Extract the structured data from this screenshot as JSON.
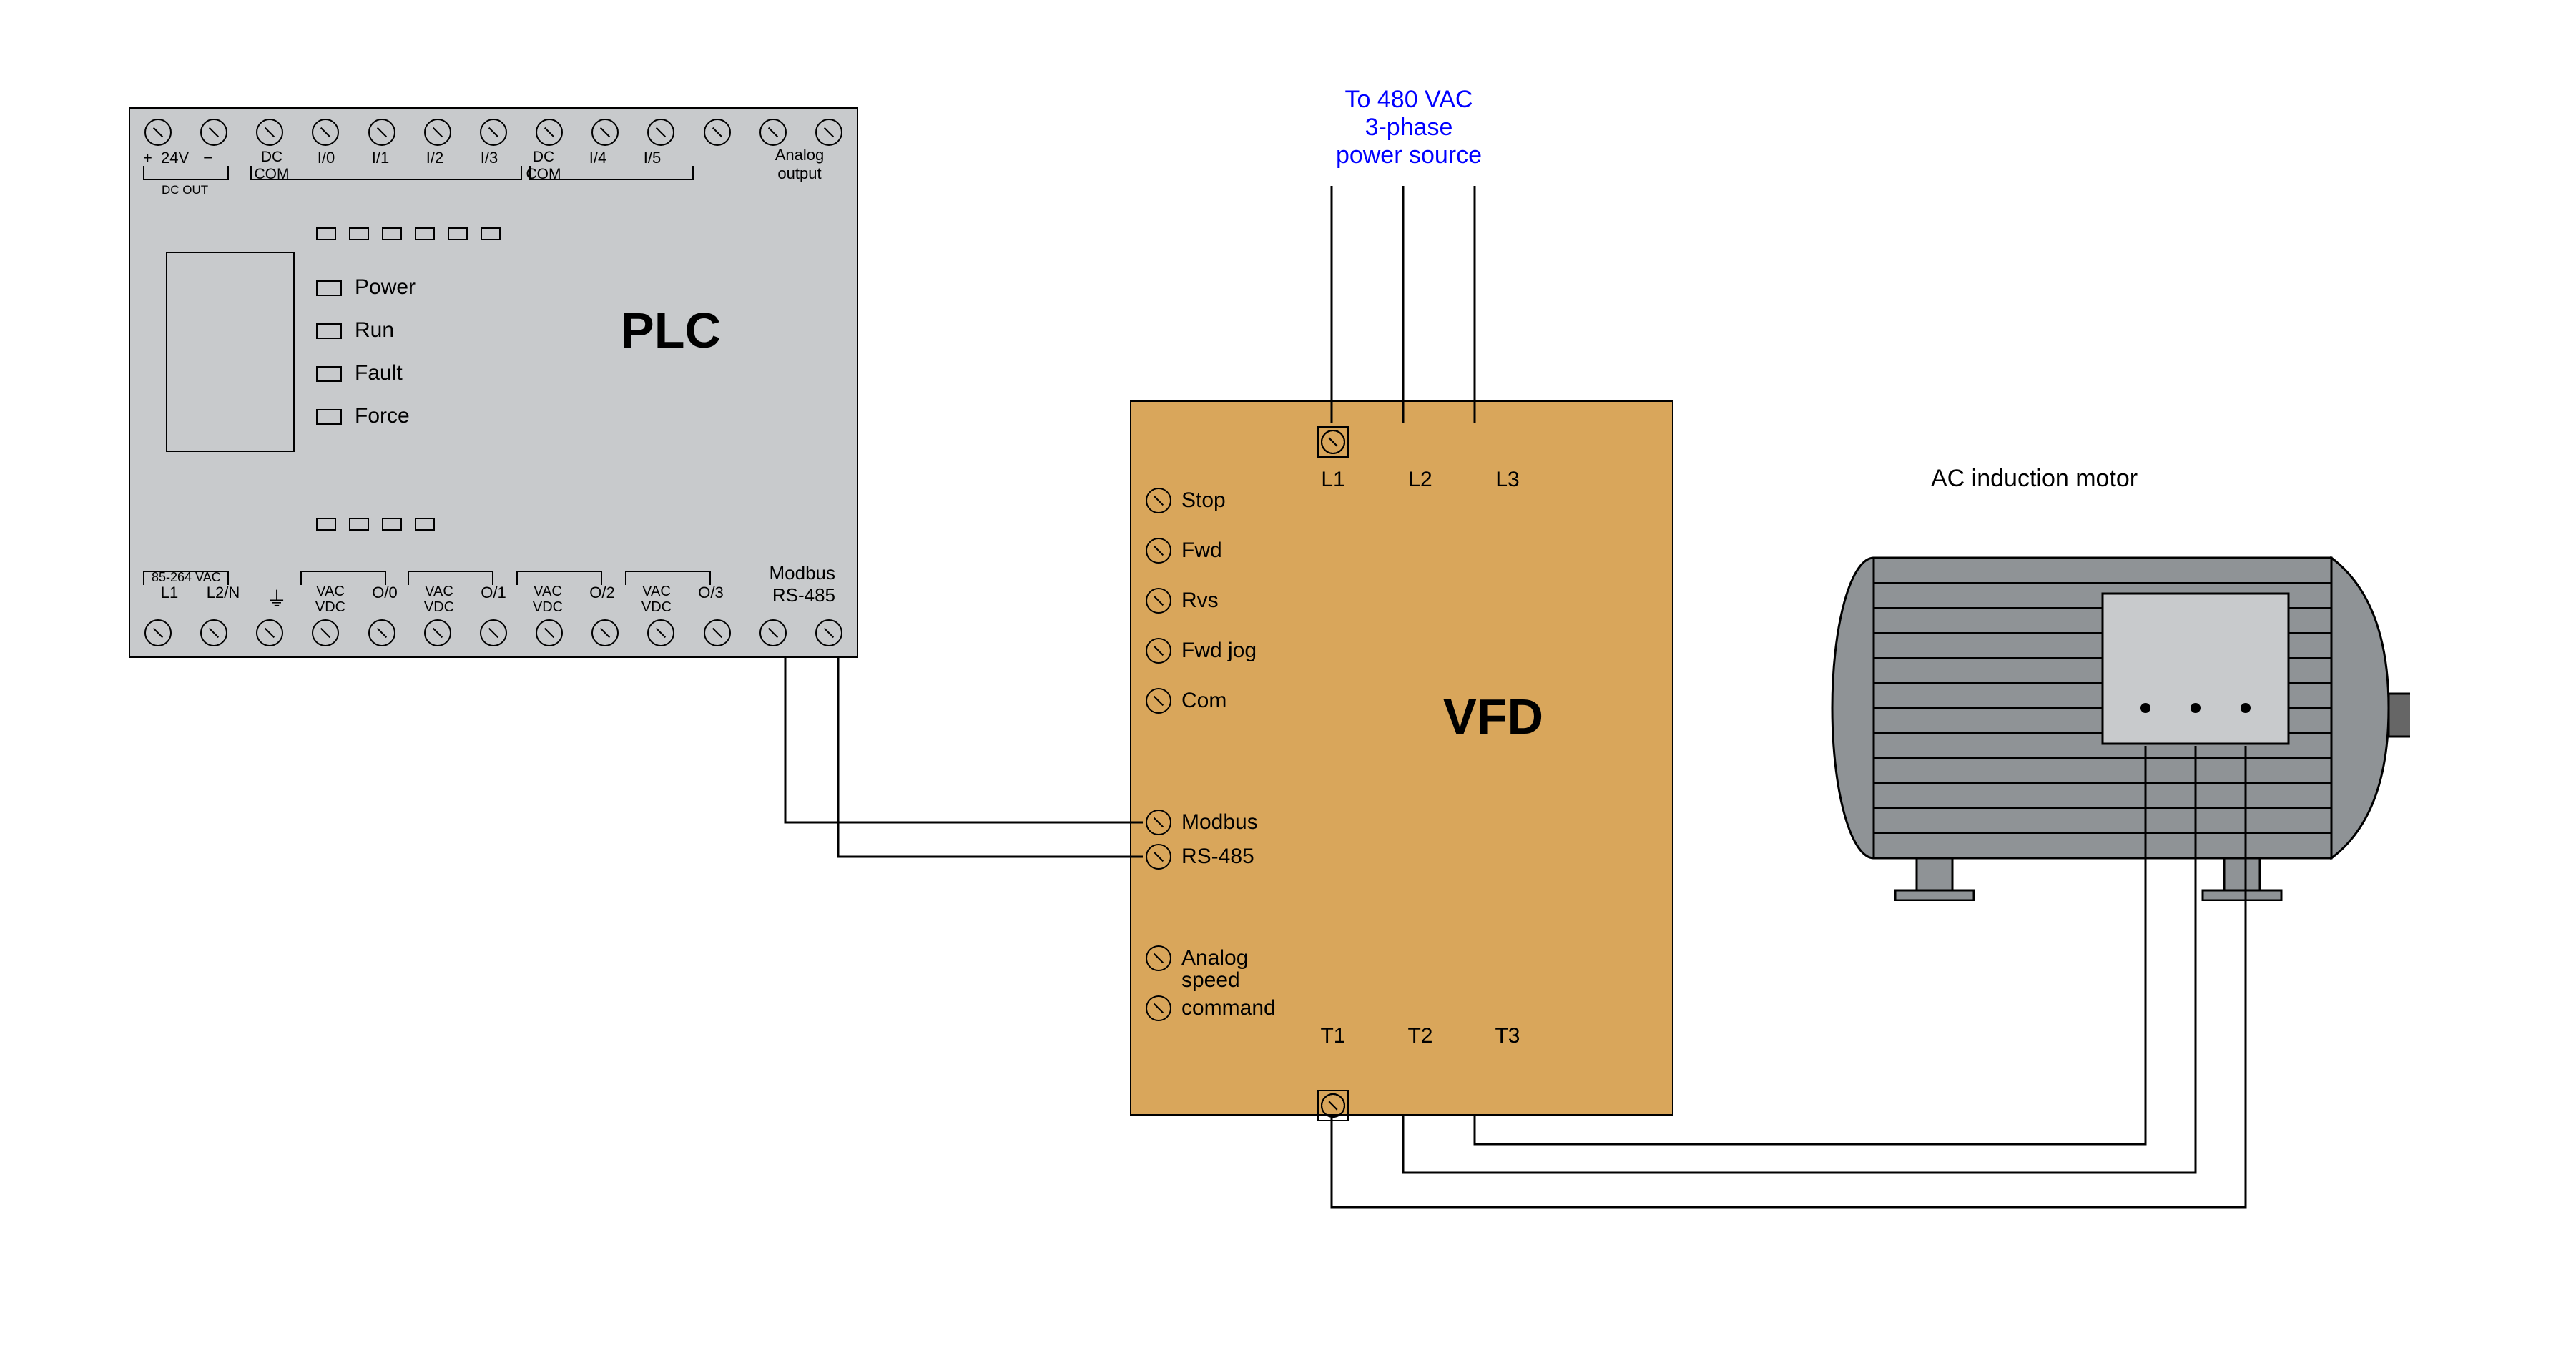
{
  "power_source_label": "To 480 VAC\n3-phase\npower source",
  "plc": {
    "title": "PLC",
    "dc_out_plus": "+",
    "dc_out_24v": "24V",
    "dc_out_minus": "−",
    "dc_out_text": "DC OUT",
    "top_terminals": [
      "",
      "",
      "DC\nCOM",
      "I/0",
      "I/1",
      "I/2",
      "I/3",
      "DC\nCOM",
      "I/4",
      "I/5",
      "",
      "",
      ""
    ],
    "analog_output": "Analog\noutput",
    "status": {
      "power": "Power",
      "run": "Run",
      "fault": "Fault",
      "force": "Force"
    },
    "power_spec": "85-264 VAC",
    "bottom_terminals": [
      "L1",
      "L2/N",
      "⏚",
      "VAC\nVDC",
      "O/0",
      "VAC\nVDC",
      "O/1",
      "VAC\nVDC",
      "O/2",
      "VAC\nVDC",
      "O/3",
      "",
      ""
    ],
    "modbus": "Modbus\nRS-485"
  },
  "vfd": {
    "title": "VFD",
    "top_terminals": [
      "L1",
      "L2",
      "L3"
    ],
    "bottom_terminals": [
      "T1",
      "T2",
      "T3"
    ],
    "left_terminals": [
      "Stop",
      "Fwd",
      "Rvs",
      "Fwd jog",
      "Com"
    ],
    "modbus_line1": "Modbus",
    "modbus_line2": "RS-485",
    "analog_line1": "Analog",
    "analog_line2": "speed",
    "analog_line3": "command"
  },
  "motor": {
    "label": "AC induction motor"
  }
}
